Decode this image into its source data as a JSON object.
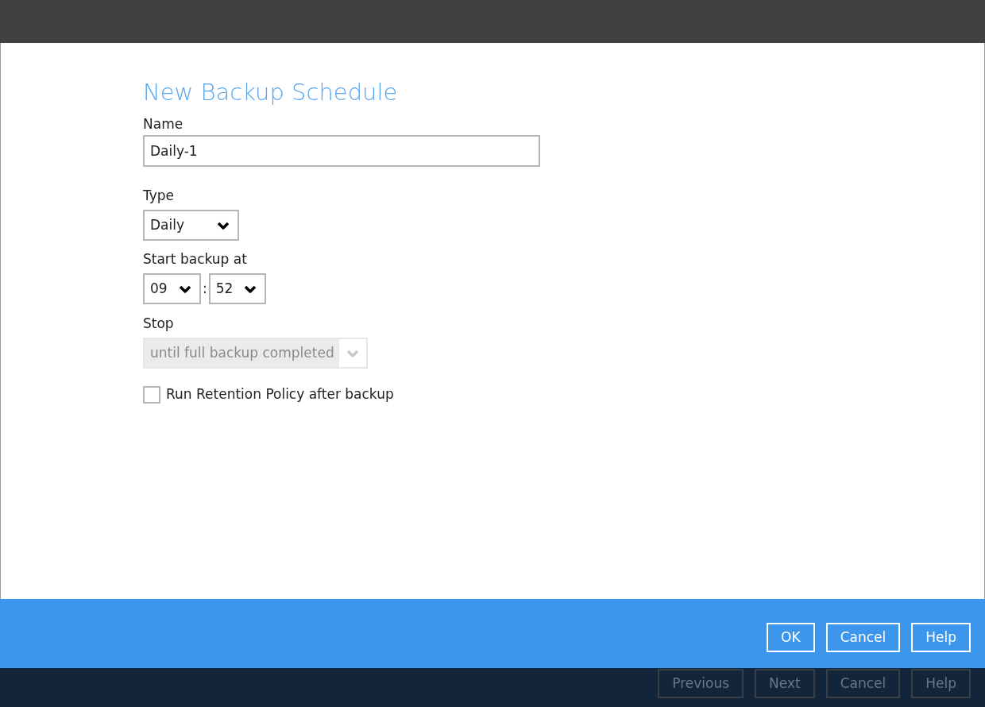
{
  "title": "New Backup Schedule",
  "name_field": {
    "label": "Name",
    "value": "Daily-1"
  },
  "type_field": {
    "label": "Type",
    "value": "Daily",
    "disabled": false
  },
  "start_time": {
    "label": "Start backup at",
    "hour": "09",
    "separator": ":",
    "minute": "52"
  },
  "stop_field": {
    "label": "Stop",
    "value": "until full backup completed",
    "disabled": true
  },
  "retention_checkbox": {
    "label": "Run Retention Policy after backup",
    "checked": false
  },
  "dialog_buttons": [
    {
      "label": "OK",
      "disabled": false
    },
    {
      "label": "Cancel",
      "disabled": false
    },
    {
      "label": "Help",
      "disabled": false
    }
  ],
  "wizard_buttons": [
    {
      "label": "Previous",
      "disabled": true
    },
    {
      "label": "Next",
      "disabled": true
    },
    {
      "label": "Cancel",
      "disabled": true
    },
    {
      "label": "Help",
      "disabled": true
    }
  ]
}
